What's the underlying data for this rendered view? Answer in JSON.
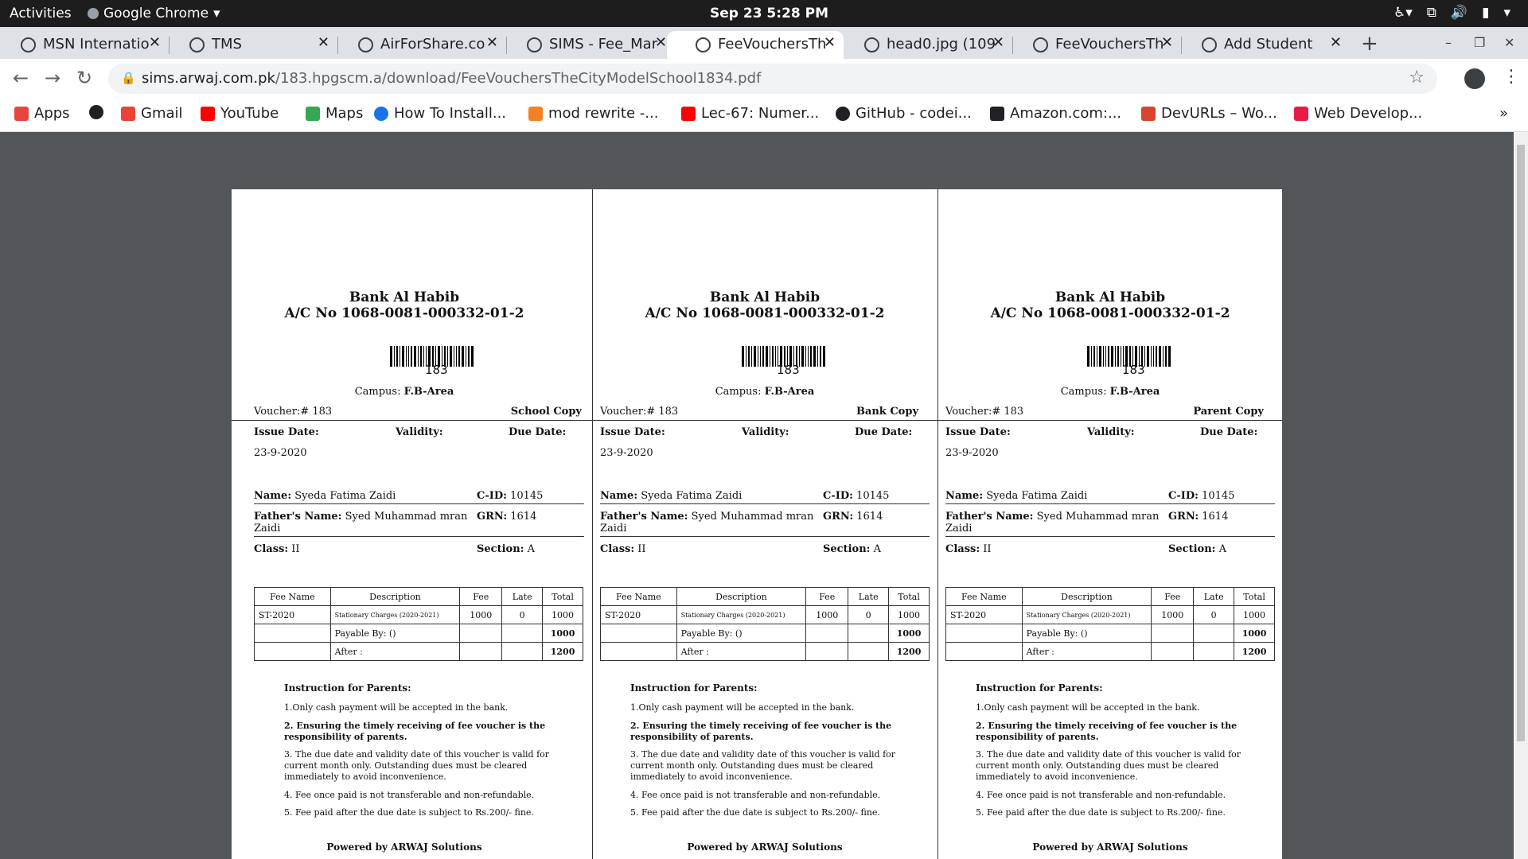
{
  "system": {
    "activities": "Activities",
    "app_name": "Google Chrome",
    "clock": "Sep 23   5:28 PM"
  },
  "tabs": [
    {
      "title": "MSN Internatio",
      "active": false
    },
    {
      "title": "TMS",
      "active": false
    },
    {
      "title": "AirForShare.co",
      "active": false
    },
    {
      "title": "SIMS - Fee_Mar",
      "active": false
    },
    {
      "title": "FeeVouchersTh",
      "active": true
    },
    {
      "title": "head0.jpg (109",
      "active": false
    },
    {
      "title": "FeeVouchersTh",
      "active": false
    },
    {
      "title": "Add Student",
      "active": false
    }
  ],
  "toolbar": {
    "url_domain": "sims.arwaj.com.pk",
    "url_path": "/183.hpgscm.a/download/FeeVouchersTheCityModelSchool1834.pdf"
  },
  "bookmarks": [
    {
      "label": "Apps",
      "icon": "apps-grid-icon",
      "color": "#e8453c"
    },
    {
      "label": "",
      "icon": "globe-icon",
      "color": "#202124"
    },
    {
      "label": "Gmail",
      "icon": "gmail-icon",
      "color": "#ea4335"
    },
    {
      "label": "YouTube",
      "icon": "youtube-icon",
      "color": "#ff0000"
    },
    {
      "label": "Maps",
      "icon": "maps-pin-icon",
      "color": "#34a853"
    },
    {
      "label": "How To Install...",
      "icon": "refresh-blue-icon",
      "color": "#1a73e8"
    },
    {
      "label": "mod rewrite -...",
      "icon": "stackoverflow-icon",
      "color": "#f48024"
    },
    {
      "label": "Lec-67: Numer...",
      "icon": "youtube-icon",
      "color": "#ff0000"
    },
    {
      "label": "GitHub - codei...",
      "icon": "github-icon",
      "color": "#202124"
    },
    {
      "label": "Amazon.com:...",
      "icon": "amazon-icon",
      "color": "#202124"
    },
    {
      "label": "DevURLs – Wo...",
      "icon": "devurls-icon",
      "color": "#d9442f"
    },
    {
      "label": "Web Develop...",
      "icon": "web-dev-icon",
      "color": "#e81b46"
    }
  ],
  "bookmarks_overflow": "»",
  "voucher": {
    "bank": "Bank Al Habib",
    "account": "A/C No 1068-0081-000332-01-2",
    "barcode_number": "183",
    "campus_label": "Campus:",
    "campus_value": "F.B-Area",
    "voucher_no": "Voucher:# 183",
    "issue_date_label": "Issue Date:",
    "validity_label": "Validity:",
    "due_date_label": "Due Date:",
    "issue_date": "23-9-2020",
    "name_label": "Name:",
    "name": "Syeda Fatima Zaidi",
    "cid_label": "C-ID:",
    "cid": "10145",
    "father_label": "Father's Name:",
    "father_line1": "Syed  Muhammad  mran",
    "father_line2": "Zaidi",
    "grn_label": "GRN:",
    "grn": "1614",
    "class_label": "Class:",
    "class": "II",
    "section_label": "Section:",
    "section": "A",
    "table_headers": [
      "Fee Name",
      "Description",
      "Fee",
      "Late",
      "Total"
    ],
    "fee_row": {
      "name": "ST-2020",
      "description": "Stationary Charges (2020-2021)",
      "fee": "1000",
      "late": "0",
      "total": "1000"
    },
    "payable_label": "Payable By: ()",
    "payable_total": "1000",
    "after_label": "After :",
    "after_total": "1200",
    "instructions_title": "Instruction for Parents:",
    "instructions": [
      "1.Only cash payment will be accepted in the bank.",
      "2.  Ensuring the timely receiving of fee voucher is the responsibility of parents.",
      "3.  The due date and validity date of this voucher is valid for current month only. Outstanding dues must be cleared immediately to avoid inconvenience.",
      "4. Fee once paid is not transferable and non-refundable.",
      "5. Fee paid after the due date is subject to Rs.200/- fine."
    ],
    "powered_by": "Powered by ARWAJ Solutions"
  },
  "copies": [
    "School Copy",
    "Bank Copy",
    "Parent Copy"
  ]
}
